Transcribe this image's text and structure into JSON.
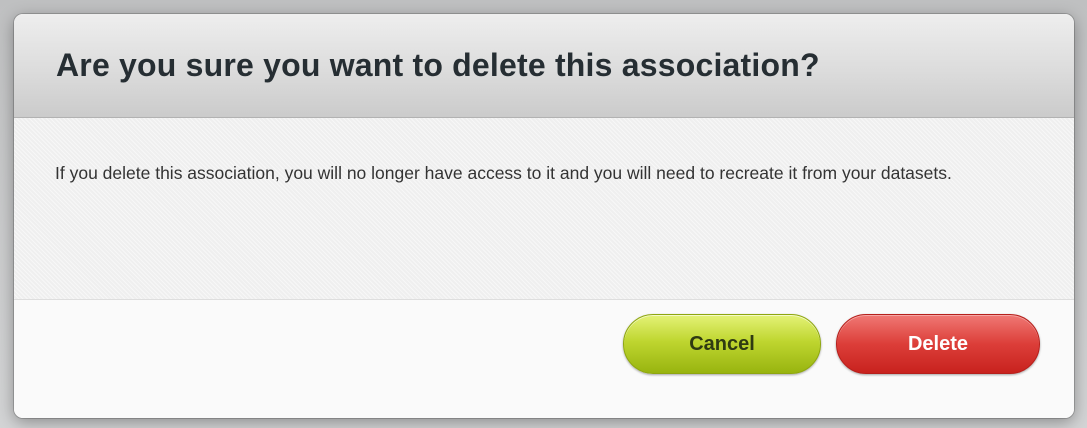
{
  "dialog": {
    "title": "Are you sure you want to delete this association?",
    "message": "If you delete this association, you will no longer have access to it and you will need to recreate it from your datasets."
  },
  "buttons": {
    "cancel_label": "Cancel",
    "delete_label": "Delete"
  },
  "colors": {
    "cancel_button": "#bfd630",
    "delete_button": "#dc3e39",
    "title_text": "#262e33"
  }
}
